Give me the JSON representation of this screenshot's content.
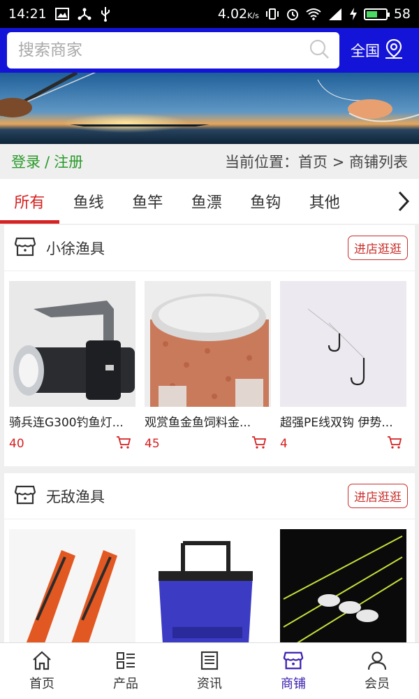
{
  "status": {
    "time": "14:21",
    "speed": "4.02",
    "speed_unit": "K/s",
    "battery": "58",
    "battery_level": 0.58
  },
  "header": {
    "search_placeholder": "搜索商家",
    "region": "全国"
  },
  "location": {
    "login": "登录",
    "sep": "/",
    "register": "注册",
    "breadcrumb": "当前位置：首页 > 商铺列表"
  },
  "tabs": [
    {
      "label": "所有",
      "active": true
    },
    {
      "label": "鱼线"
    },
    {
      "label": "鱼竿"
    },
    {
      "label": "鱼漂"
    },
    {
      "label": "鱼钩"
    },
    {
      "label": "其他"
    }
  ],
  "shops": [
    {
      "name": "小徐渔具",
      "visit_label": "进店逛逛",
      "products": [
        {
          "name": "骑兵连G300钓鱼灯...",
          "price": "40"
        },
        {
          "name": "观赏鱼金鱼饲料金...",
          "price": "45"
        },
        {
          "name": "超强PE线双钩 伊势...",
          "price": "4"
        }
      ]
    },
    {
      "name": "无敌渔具",
      "visit_label": "进店逛逛",
      "products": [
        {
          "name": "",
          "price": ""
        },
        {
          "name": "",
          "price": ""
        },
        {
          "name": "",
          "price": ""
        }
      ]
    }
  ],
  "bottom_nav": [
    {
      "label": "首页",
      "icon": "home-icon"
    },
    {
      "label": "产品",
      "icon": "product-list-icon"
    },
    {
      "label": "资讯",
      "icon": "news-icon"
    },
    {
      "label": "商铺",
      "icon": "shop-icon",
      "active": true
    },
    {
      "label": "会员",
      "icon": "member-icon"
    }
  ],
  "colors": {
    "header_blue": "#1414d8",
    "accent_red": "#d62222",
    "login_green": "#2a9a2a",
    "nav_active": "#3a1fb0"
  }
}
